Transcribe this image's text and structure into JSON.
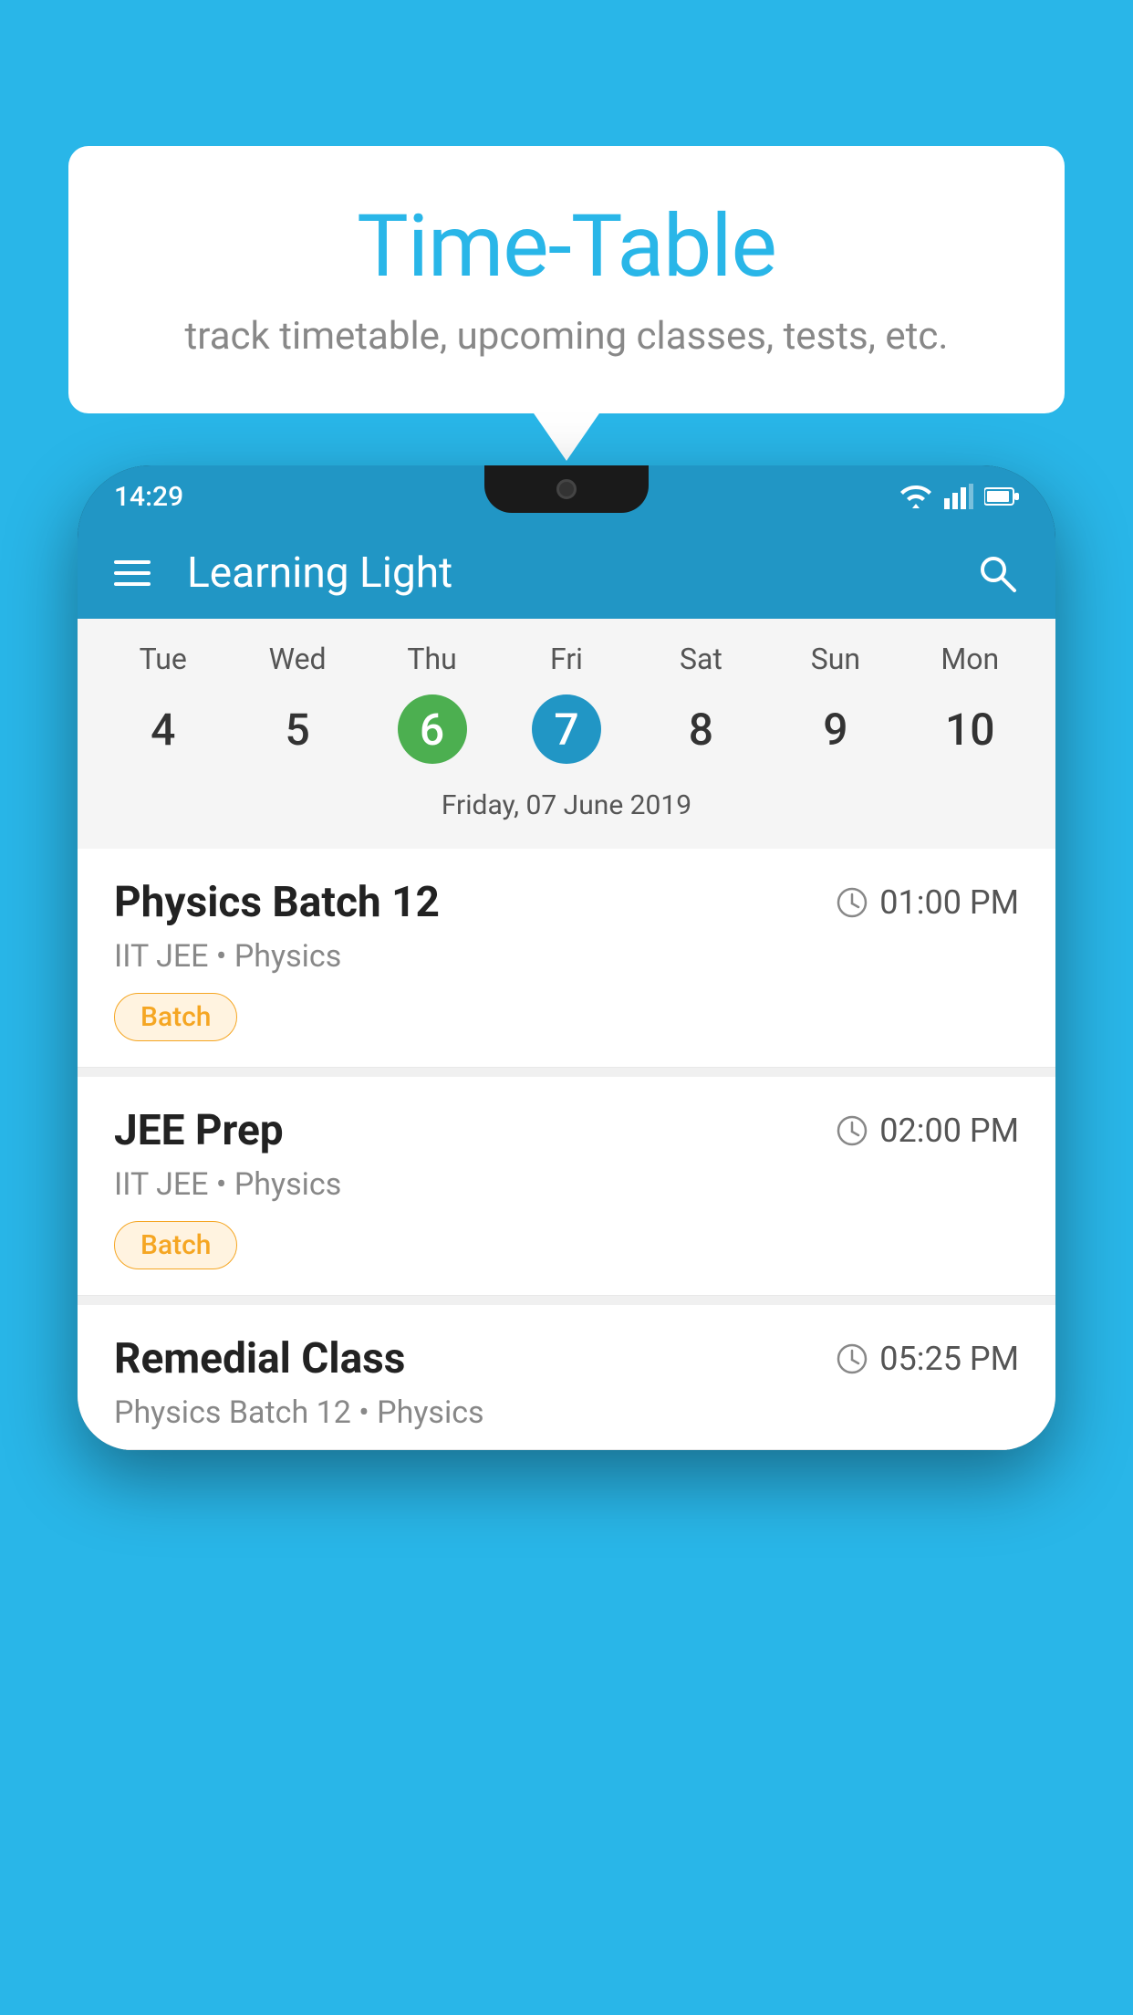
{
  "background": {
    "color": "#29b6e8"
  },
  "speech_bubble": {
    "title": "Time-Table",
    "subtitle": "track timetable, upcoming classes, tests, etc."
  },
  "phone": {
    "status_bar": {
      "time": "14:29",
      "icons": [
        "wifi",
        "signal",
        "battery"
      ]
    },
    "app_bar": {
      "title": "Learning Light"
    },
    "calendar": {
      "days": [
        "Tue",
        "Wed",
        "Thu",
        "Fri",
        "Sat",
        "Sun",
        "Mon"
      ],
      "dates": [
        "4",
        "5",
        "6",
        "7",
        "8",
        "9",
        "10"
      ],
      "today_index": 2,
      "selected_index": 3,
      "selected_date_label": "Friday, 07 June 2019"
    },
    "schedule": [
      {
        "title": "Physics Batch 12",
        "time": "01:00 PM",
        "subtitle": "IIT JEE • Physics",
        "tag": "Batch"
      },
      {
        "title": "JEE Prep",
        "time": "02:00 PM",
        "subtitle": "IIT JEE • Physics",
        "tag": "Batch"
      },
      {
        "title": "Remedial Class",
        "time": "05:25 PM",
        "subtitle": "Physics Batch 12 • Physics",
        "tag": ""
      }
    ]
  }
}
